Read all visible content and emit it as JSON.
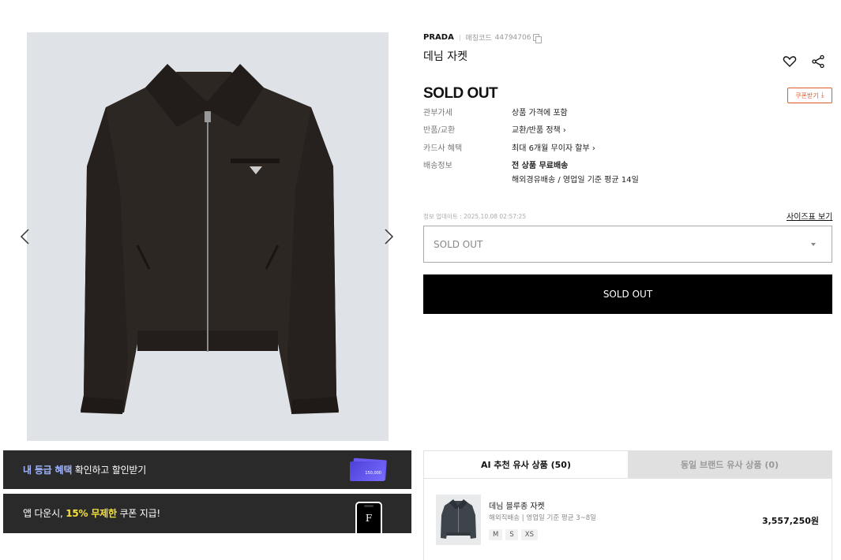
{
  "gallery": {
    "image_alt": "Prada denim bomber jacket",
    "prev_icon": "chevron-left-icon",
    "next_icon": "chevron-right-icon"
  },
  "banners": [
    {
      "highlight": "내 등급 혜택",
      "rest": " 확인하고 할인받기",
      "card_text": "150,000"
    },
    {
      "prefix": "앱 다운시, ",
      "highlight": "15% 무제한",
      "rest": " 쿠폰 지급!",
      "app_letter": "F"
    }
  ],
  "product": {
    "brand": "PRADA",
    "code_label": "매칭코드",
    "code": "44794706",
    "name": "데님 자켓",
    "price": "SOLD OUT",
    "coupon_label": "쿠폰받기"
  },
  "info_rows": [
    {
      "label": "관부가세",
      "value": "상품 가격에 포함"
    },
    {
      "label": "반품/교환",
      "value": "교환/반품 정책 ›"
    },
    {
      "label": "카드사 혜택",
      "value": "최대 6개월 무이자 할부 ›"
    },
    {
      "label": "배송정보",
      "value": "전 상품 무료배송",
      "value2": "해외경유배송 / 영업일 기준 평균 14일"
    }
  ],
  "update_time": "정보 업데이트 : 2025.10.08 02:57:25",
  "size_guide": "사이즈표 보기",
  "option_select": {
    "selected": "SOLD OUT"
  },
  "cta_label": "SOLD OUT",
  "recommendations": {
    "tabs": [
      {
        "label": "AI 추천 유사 상품 (50)",
        "active": true
      },
      {
        "label": "동일 브랜드 유사 상품 (0)",
        "active": false
      }
    ],
    "item": {
      "name": "데님 블루종 자켓",
      "shipping": "해외직배송 | 영업일 기준 평균 3~8일",
      "sizes": [
        "M",
        "S",
        "XS"
      ],
      "price": "3,557,250원"
    }
  },
  "colors": {
    "accent_orange": "#e05a2b",
    "banner_bg": "#2a2a2a",
    "highlight_blue": "#9fb4ff",
    "highlight_yellow": "#f5e23a",
    "cta_bg": "#000000"
  }
}
